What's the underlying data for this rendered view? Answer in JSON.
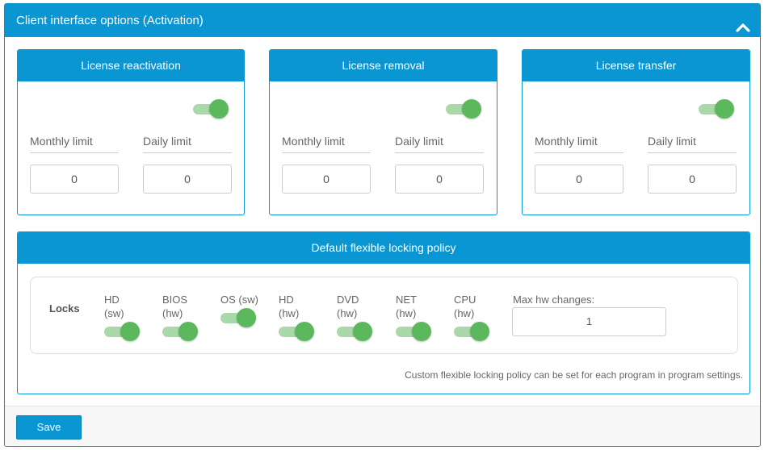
{
  "panel": {
    "title": "Client interface options (Activation)"
  },
  "cards": [
    {
      "title": "License reactivation",
      "enabled": true,
      "monthly_label": "Monthly limit",
      "daily_label": "Daily limit",
      "monthly_value": "0",
      "daily_value": "0"
    },
    {
      "title": "License removal",
      "enabled": true,
      "monthly_label": "Monthly limit",
      "daily_label": "Daily limit",
      "monthly_value": "0",
      "daily_value": "0"
    },
    {
      "title": "License transfer",
      "enabled": true,
      "monthly_label": "Monthly limit",
      "daily_label": "Daily limit",
      "monthly_value": "0",
      "daily_value": "0"
    }
  ],
  "policy": {
    "title": "Default flexible locking policy",
    "locks_label": "Locks",
    "locks": [
      {
        "line1": "HD",
        "line2": "(sw)",
        "enabled": true
      },
      {
        "line1": "BIOS",
        "line2": "(hw)",
        "enabled": true
      },
      {
        "line1": "OS (sw)",
        "line2": "",
        "enabled": true
      },
      {
        "line1": "HD",
        "line2": "(hw)",
        "enabled": true
      },
      {
        "line1": "DVD",
        "line2": "(hw)",
        "enabled": true
      },
      {
        "line1": "NET",
        "line2": "(hw)",
        "enabled": true
      },
      {
        "line1": "CPU",
        "line2": "(hw)",
        "enabled": true
      }
    ],
    "max_hw_label": "Max hw changes:",
    "max_hw_value": "1",
    "note": "Custom flexible locking policy can be set for each program in program settings."
  },
  "footer": {
    "save_label": "Save"
  },
  "colors": {
    "accent": "#0a96d3",
    "toggle_on": "#5cb85c"
  }
}
